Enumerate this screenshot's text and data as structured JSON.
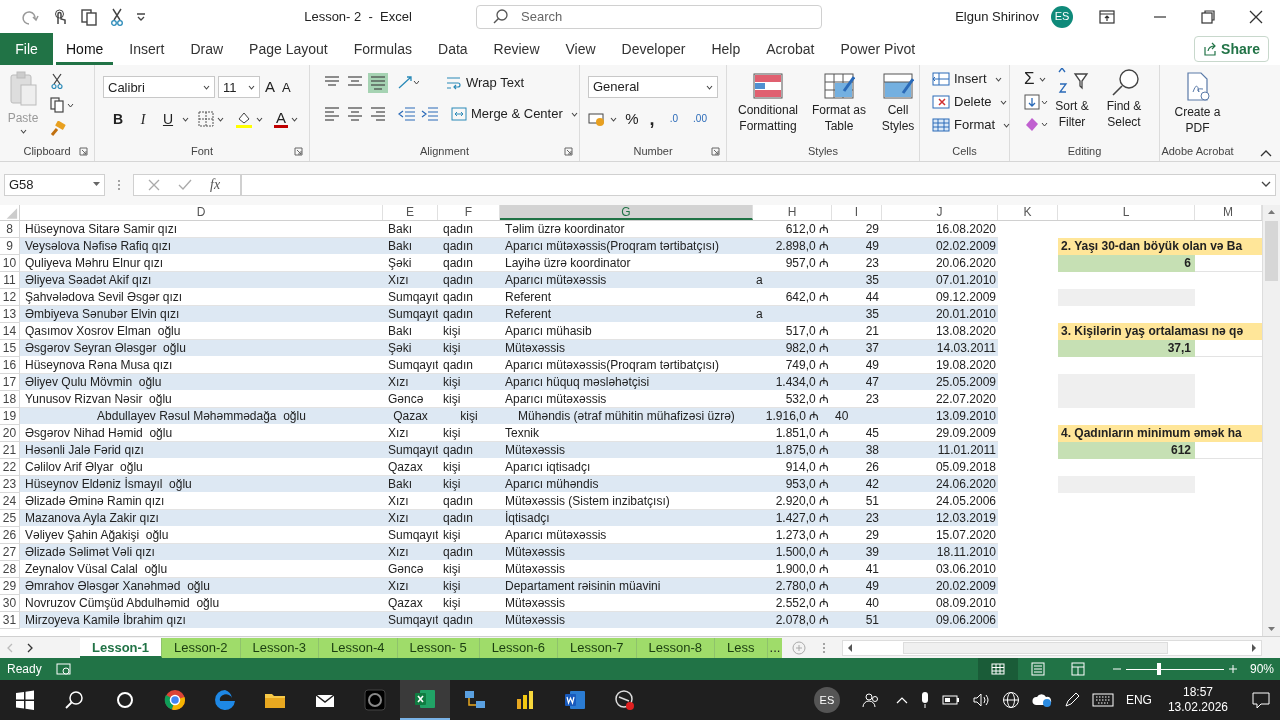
{
  "window": {
    "title": "Lesson- 2  -  Excel",
    "search_placeholder": "Search",
    "user": "Elgun Shirinov",
    "avatar": "ES"
  },
  "menu_tabs": [
    {
      "label": "File",
      "kind": "file",
      "selected": false
    },
    {
      "label": "Home",
      "kind": "tab",
      "selected": true
    },
    {
      "label": "Insert",
      "kind": "tab",
      "selected": false
    },
    {
      "label": "Draw",
      "kind": "tab",
      "selected": false
    },
    {
      "label": "Page Layout",
      "kind": "tab",
      "selected": false
    },
    {
      "label": "Formulas",
      "kind": "tab",
      "selected": false
    },
    {
      "label": "Data",
      "kind": "tab",
      "selected": false
    },
    {
      "label": "Review",
      "kind": "tab",
      "selected": false
    },
    {
      "label": "View",
      "kind": "tab",
      "selected": false
    },
    {
      "label": "Developer",
      "kind": "tab",
      "selected": false
    },
    {
      "label": "Help",
      "kind": "tab",
      "selected": false
    },
    {
      "label": "Acrobat",
      "kind": "tab",
      "selected": false
    },
    {
      "label": "Power Pivot",
      "kind": "tab",
      "selected": false
    }
  ],
  "share": "Share",
  "ribbon": {
    "clipboard": {
      "paste": "Paste",
      "label": "Clipboard"
    },
    "font": {
      "name": "Calibri",
      "size": "11",
      "grow": "A",
      "shrink": "A",
      "styles": [
        "B",
        "I",
        "U"
      ],
      "color_letter": "A",
      "label": "Font"
    },
    "alignment": {
      "wrap": "Wrap Text",
      "merge": "Merge & Center",
      "label": "Alignment"
    },
    "number": {
      "format": "General",
      "percent": "%",
      "comma": ",",
      "decimals": [
        ".0",
        ".00"
      ],
      "label": "Number"
    },
    "styles": {
      "buttons": [
        "Conditional Formatting",
        "Format as Table",
        "Cell Styles"
      ],
      "label": "Styles"
    },
    "cells": {
      "buttons": [
        "Insert",
        "Delete",
        "Format"
      ],
      "label": "Cells"
    },
    "editing": {
      "sum": "Σ",
      "buttons": [
        "Sort & Filter",
        "Find & Select"
      ],
      "label": "Editing"
    },
    "acrobat": {
      "button": "Create a PDF",
      "label": "Adobe Acrobat"
    }
  },
  "formula_bar": {
    "name_box": "G58",
    "fx": "fx"
  },
  "columns": [
    {
      "label": "D",
      "selected": false
    },
    {
      "label": "E",
      "selected": false
    },
    {
      "label": "F",
      "selected": false
    },
    {
      "label": "G",
      "selected": true
    },
    {
      "label": "H",
      "selected": false
    },
    {
      "label": "I",
      "selected": false
    },
    {
      "label": "J",
      "selected": false
    },
    {
      "label": "K",
      "selected": false
    },
    {
      "label": "L",
      "selected": false
    },
    {
      "label": "M",
      "selected": false
    }
  ],
  "rows": [
    {
      "row": "8",
      "kind": "normal",
      "cells": [
        "Hüseynova Sitarə Samir qızı",
        "Bakı",
        "qadın",
        "Təlim üzrə koordinator",
        "612,0 ₼",
        "29",
        "16.08.2020"
      ]
    },
    {
      "row": "9",
      "kind": "normal",
      "cells": [
        "Veysəlova Nəfisə Rafiq qızı",
        "Bakı",
        "qadın",
        "Aparıcı mütəxəssis(Proqram tərtibatçısı)",
        "2.898,0 ₼",
        "49",
        "02.02.2009"
      ],
      "side": {
        "kind": "question",
        "text": "2. Yaşı 30-dan böyük olan və Ba"
      }
    },
    {
      "row": "10",
      "kind": "normal",
      "cells": [
        "Quliyeva Məhru Elnur qızı",
        "Şəki",
        "qadın",
        "Layihə üzrə koordinator",
        "957,0 ₼",
        "23",
        "20.06.2020"
      ],
      "side": {
        "kind": "answer",
        "text": "6"
      }
    },
    {
      "row": "11",
      "kind": "normal",
      "cells": [
        "Əliyeva Səadət Akif qızı",
        "Xızı",
        "qadın",
        "Aparıcı mütəxəssis",
        "a",
        "35",
        "07.01.2010"
      ]
    },
    {
      "row": "12",
      "kind": "normal",
      "cells": [
        "Şahvələdova Sevil Əsgər qızı",
        "Sumqayıt",
        "qadın",
        "Referent",
        "642,0 ₼",
        "44",
        "09.12.2009"
      ],
      "side": {
        "kind": "blank"
      }
    },
    {
      "row": "13",
      "kind": "normal",
      "cells": [
        "Əmbiyeva Sənubər Elvin qızı",
        "Sumqayıt",
        "qadın",
        "Referent",
        "a",
        "35",
        "20.01.2010"
      ]
    },
    {
      "row": "14",
      "kind": "normal",
      "cells": [
        "Qasımov Xosrov Elman  oğlu",
        "Bakı",
        "kişi",
        "Aparıcı mühasib",
        "517,0 ₼",
        "21",
        "13.08.2020"
      ],
      "side": {
        "kind": "question",
        "text": "3. Kişilərin yaş ortalaması nə qə"
      }
    },
    {
      "row": "15",
      "kind": "normal",
      "cells": [
        "Əsgərov Seyran Ələsgər  oğlu",
        "Şəki",
        "kişi",
        "Mütəxəssis",
        "982,0 ₼",
        "37",
        "14.03.2011"
      ],
      "side": {
        "kind": "answer",
        "text": "37,1"
      }
    },
    {
      "row": "16",
      "kind": "normal",
      "cells": [
        "Hüseynova Rəna Musa qızı",
        "Sumqayıt",
        "qadın",
        "Aparıcı mütəxəssis(Proqram tərtibatçısı)",
        "749,0 ₼",
        "49",
        "19.08.2020"
      ]
    },
    {
      "row": "17",
      "kind": "normal",
      "cells": [
        "Əliyev Qulu Mövmin  oğlu",
        "Xızı",
        "kişi",
        "Aparıcı hüquq məsləhətçisi",
        "1.434,0 ₼",
        "47",
        "25.05.2009"
      ],
      "side": {
        "kind": "blank"
      }
    },
    {
      "row": "18",
      "kind": "normal",
      "cells": [
        "Yunusov Rizvan Nəsir  oğlu",
        "Gəncə",
        "kişi",
        "Aparıcı mütəxəssis",
        "532,0 ₼",
        "23",
        "22.07.2020"
      ],
      "side": {
        "kind": "blank"
      }
    },
    {
      "row": "19",
      "kind": "centered",
      "cells": [
        "Abdullayev Rəsul Məhəmmədağa  oğlu",
        "Qazax",
        "kişi",
        "Mühəndis (ətraf mühitin mühafizəsi üzrə)",
        "1.916,0 ₼",
        "40",
        "13.09.2010"
      ]
    },
    {
      "row": "20",
      "kind": "normal",
      "cells": [
        "Əsgərov Nihad Həmid  oğlu",
        "Xızı",
        "kişi",
        "Texnik",
        "1.851,0 ₼",
        "45",
        "29.09.2009"
      ],
      "side": {
        "kind": "question",
        "text": "4. Qadınların minimum əmək ha"
      }
    },
    {
      "row": "21",
      "kind": "normal",
      "cells": [
        "Həsənli Jalə Fərid qızı",
        "Sumqayıt",
        "qadın",
        "Mütəxəssis",
        "1.875,0 ₼",
        "38",
        "11.01.2011"
      ],
      "side": {
        "kind": "answer",
        "text": "612"
      }
    },
    {
      "row": "22",
      "kind": "normal",
      "cells": [
        "Cəlilov Arif Əlyar  oğlu",
        "Qazax",
        "kişi",
        "Aparıcı iqtisadçı",
        "914,0 ₼",
        "26",
        "05.09.2018"
      ]
    },
    {
      "row": "23",
      "kind": "normal",
      "cells": [
        "Hüseynov Eldəniz İsmayıl  oğlu",
        "Bakı",
        "kişi",
        "Aparıcı mühəndis",
        "953,0 ₼",
        "42",
        "24.06.2020"
      ],
      "side": {
        "kind": "blank"
      }
    },
    {
      "row": "24",
      "kind": "normal",
      "cells": [
        "Əlizadə Əminə Ramin qızı",
        "Xızı",
        "qadın",
        "Mütəxəssis (Sistem inzibatçısı)",
        "2.920,0 ₼",
        "51",
        "24.05.2006"
      ]
    },
    {
      "row": "25",
      "kind": "normal",
      "cells": [
        "Mazanova Ayla Zakir qızı",
        "Xızı",
        "qadın",
        "İqtisadçı",
        "1.427,0 ₼",
        "23",
        "12.03.2019"
      ]
    },
    {
      "row": "26",
      "kind": "normal",
      "cells": [
        "Vəliyev Şahin Ağakişi  oğlu",
        "Sumqayıt",
        "kişi",
        "Aparıcı mütəxəssis",
        "1.273,0 ₼",
        "29",
        "15.07.2020"
      ]
    },
    {
      "row": "27",
      "kind": "normal",
      "cells": [
        "Əlizadə Səlimət Vəli qızı",
        "Xızı",
        "qadın",
        "Mütəxəssis",
        "1.500,0 ₼",
        "39",
        "18.11.2010"
      ]
    },
    {
      "row": "28",
      "kind": "normal",
      "cells": [
        "Zeynalov Vüsal Calal  oğlu",
        "Gəncə",
        "kişi",
        "Mütəxəssis",
        "1.900,0 ₼",
        "41",
        "03.06.2010"
      ]
    },
    {
      "row": "29",
      "kind": "normal",
      "cells": [
        "Əmrahov Ələsgər Xanəhməd  oğlu",
        "Xızı",
        "kişi",
        "Departament rəisinin müavini",
        "2.780,0 ₼",
        "49",
        "20.02.2009"
      ]
    },
    {
      "row": "30",
      "kind": "normal",
      "cells": [
        "Novruzov Cümşüd Abdulhəmid  oğlu",
        "Qazax",
        "kişi",
        "Mütəxəssis",
        "2.552,0 ₼",
        "40",
        "08.09.2010"
      ]
    },
    {
      "row": "31",
      "kind": "normal",
      "cells": [
        "Mirzoyeva Kamilə İbrahim qızı",
        "Sumqayıt",
        "qadın",
        "Mütəxəssis",
        "2.078,0 ₼",
        "51",
        "09.06.2006"
      ]
    }
  ],
  "sheet_tabs": [
    {
      "label": "Lesson-1",
      "selected": true
    },
    {
      "label": "Lesson-2",
      "selected": false
    },
    {
      "label": "Lesson-3",
      "selected": false
    },
    {
      "label": "Lesson-4",
      "selected": false
    },
    {
      "label": "Lesson- 5",
      "selected": false
    },
    {
      "label": "Lesson-6",
      "selected": false
    },
    {
      "label": "Lesson-7",
      "selected": false
    },
    {
      "label": "Lesson-8",
      "selected": false
    },
    {
      "label": "Less",
      "selected": false
    }
  ],
  "more_sheets": "...",
  "status_bar": {
    "status": "Ready",
    "zoom": "90%",
    "zoom_slider": {
      "level": 0.33
    }
  },
  "taskbar": {
    "avatar": "ES",
    "language": "ENG",
    "time": "18:57",
    "date": "13.02.2026"
  }
}
